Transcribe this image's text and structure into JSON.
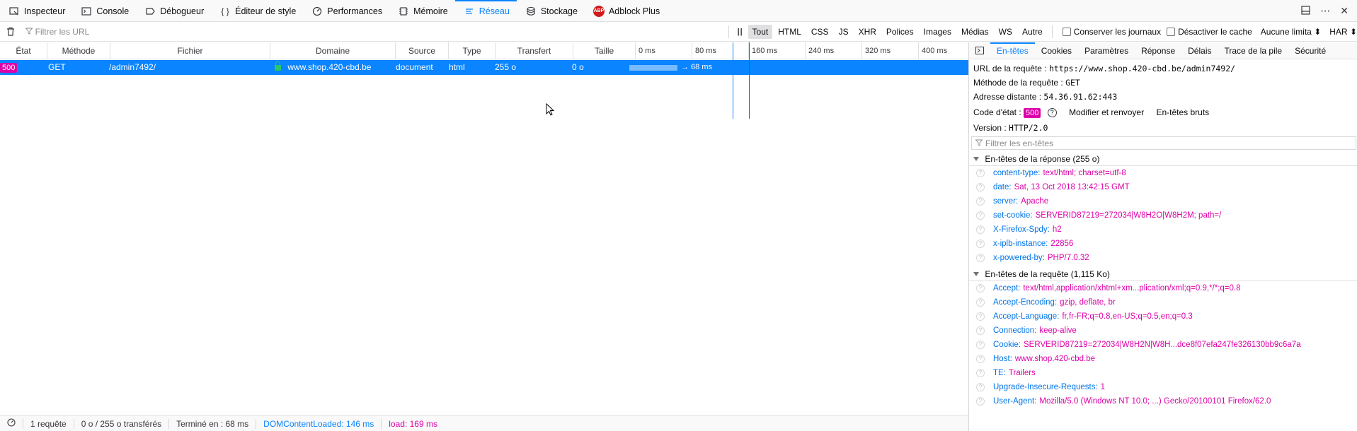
{
  "toolbar": {
    "tabs": [
      {
        "label": "Inspecteur",
        "icon": "inspector-icon"
      },
      {
        "label": "Console",
        "icon": "console-icon"
      },
      {
        "label": "Débogueur",
        "icon": "debugger-icon"
      },
      {
        "label": "Éditeur de style",
        "icon": "style-editor-icon"
      },
      {
        "label": "Performances",
        "icon": "performance-icon"
      },
      {
        "label": "Mémoire",
        "icon": "memory-icon"
      },
      {
        "label": "Réseau",
        "icon": "network-icon"
      },
      {
        "label": "Stockage",
        "icon": "storage-icon"
      },
      {
        "label": "Adblock Plus",
        "icon": "adblock-plus-icon"
      }
    ],
    "abp_badge": "ABP",
    "active_tab": "Réseau"
  },
  "filterbar": {
    "url_placeholder": "Filtrer les URL",
    "types": [
      "Tout",
      "HTML",
      "CSS",
      "JS",
      "XHR",
      "Polices",
      "Images",
      "Médias",
      "WS",
      "Autre"
    ],
    "active_type": "Tout",
    "persist_logs": "Conserver les journaux",
    "disable_cache": "Désactiver le cache",
    "throttling": "Aucune limita",
    "har": "HAR"
  },
  "table": {
    "columns": [
      "État",
      "Méthode",
      "Fichier",
      "Domaine",
      "Source",
      "Type",
      "Transfert",
      "Taille"
    ],
    "timeline_ticks": [
      "0 ms",
      "80 ms",
      "160 ms",
      "240 ms",
      "320 ms",
      "400 ms"
    ],
    "rows": [
      {
        "status": "500",
        "method": "GET",
        "file": "/admin7492/",
        "domain": "www.shop.420-cbd.be",
        "source": "document",
        "type": "html",
        "transfer": "255 o",
        "size": "0 o",
        "timing": "→ 68 ms"
      }
    ]
  },
  "statusbar": {
    "requests": "1 requête",
    "transferred": "0 o / 255 o transférés",
    "finished": "Terminé en : 68 ms",
    "dom_content_loaded": "DOMContentLoaded: 146 ms",
    "load": "load: 169 ms"
  },
  "panel": {
    "tabs": [
      "En-têtes",
      "Cookies",
      "Paramètres",
      "Réponse",
      "Délais",
      "Trace de la pile",
      "Sécurité"
    ],
    "active_tab": "En-têtes",
    "summary": {
      "url_label": "URL de la requête :",
      "url_value": "https://www.shop.420-cbd.be/admin7492/",
      "method_label": "Méthode de la requête :",
      "method_value": "GET",
      "remote_label": "Adresse distante :",
      "remote_value": "54.36.91.62:443",
      "status_label": "Code d'état :",
      "status_value": "500",
      "edit_resend": "Modifier et renvoyer",
      "raw_headers": "En-têtes bruts",
      "version_label": "Version :",
      "version_value": "HTTP/2.0"
    },
    "header_filter_placeholder": "Filtrer les en-têtes",
    "response_section": "En-têtes de la réponse (255 o)",
    "response_headers": [
      {
        "name": "content-type:",
        "value": "text/html; charset=utf-8"
      },
      {
        "name": "date:",
        "value": "Sat, 13 Oct 2018 13:42:15 GMT"
      },
      {
        "name": "server:",
        "value": "Apache"
      },
      {
        "name": "set-cookie:",
        "value": "SERVERID87219=272034|W8H2O|W8H2M; path=/"
      },
      {
        "name": "X-Firefox-Spdy:",
        "value": "h2"
      },
      {
        "name": "x-iplb-instance:",
        "value": "22856"
      },
      {
        "name": "x-powered-by:",
        "value": "PHP/7.0.32"
      }
    ],
    "request_section": "En-têtes de la requête (1,115 Ko)",
    "request_headers": [
      {
        "name": "Accept:",
        "value": "text/html,application/xhtml+xm...plication/xml;q=0.9,*/*;q=0.8"
      },
      {
        "name": "Accept-Encoding:",
        "value": "gzip, deflate, br"
      },
      {
        "name": "Accept-Language:",
        "value": "fr,fr-FR;q=0.8,en-US;q=0.5,en;q=0.3"
      },
      {
        "name": "Connection:",
        "value": "keep-alive"
      },
      {
        "name": "Cookie:",
        "value": "SERVERID87219=272034|W8H2N|W8H...dce8f07efa247fe326130bb9c6a7a"
      },
      {
        "name": "Host:",
        "value": "www.shop.420-cbd.be"
      },
      {
        "name": "TE:",
        "value": "Trailers"
      },
      {
        "name": "Upgrade-Insecure-Requests:",
        "value": "1"
      },
      {
        "name": "User-Agent:",
        "value": "Mozilla/5.0 (Windows NT 10.0; ...) Gecko/20100101 Firefox/62.0"
      }
    ]
  },
  "colors": {
    "accent": "#0a84ff",
    "status_error": "#dd00a9",
    "header_name": "#0074e8"
  }
}
